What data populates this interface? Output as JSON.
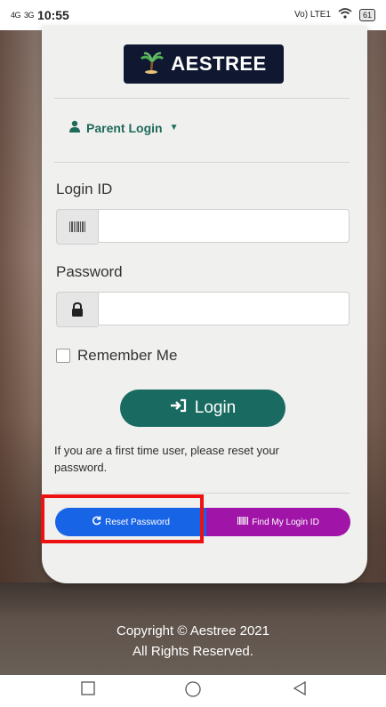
{
  "status_bar": {
    "network_1": "4G",
    "network_2": "3G",
    "time": "10:55",
    "volte": "Vo) LTE1",
    "battery": "61"
  },
  "logo": {
    "text": "AESTREE"
  },
  "login_type": {
    "label": "Parent Login"
  },
  "form": {
    "login_id_label": "Login ID",
    "login_id_value": "",
    "password_label": "Password",
    "password_value": "",
    "remember_label": "Remember Me",
    "login_button": "Login"
  },
  "info_text": "If you are a first time user, please reset your password.",
  "actions": {
    "reset_password": "Reset Password",
    "find_login_id": "Find My Login ID"
  },
  "footer": {
    "line1": "Copyright © Aestree 2021",
    "line2": "All Rights Reserved."
  },
  "colors": {
    "primary_teal": "#196b61",
    "reset_blue": "#1864e6",
    "find_purple": "#a015a8",
    "highlight_red": "#ee1111"
  }
}
